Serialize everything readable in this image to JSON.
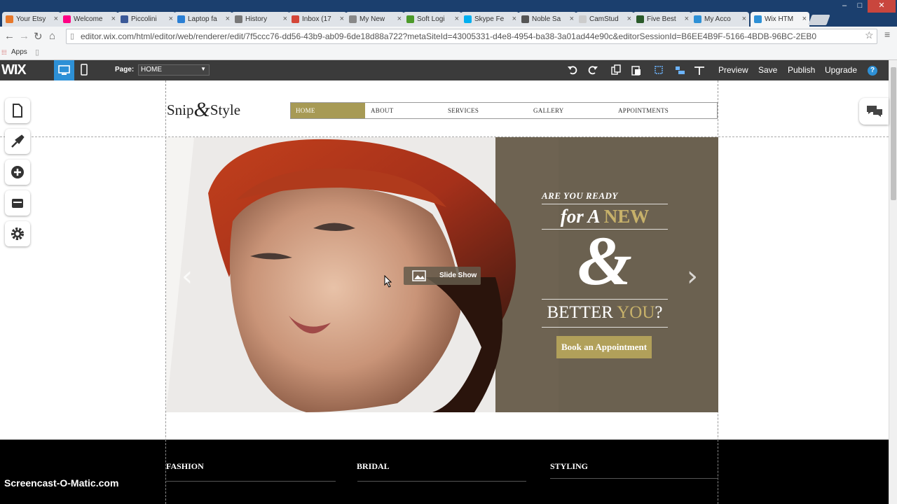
{
  "browser": {
    "tabs": [
      {
        "label": "Your Etsy",
        "color": "#e8782a"
      },
      {
        "label": "Welcome",
        "color": "#ff0084"
      },
      {
        "label": "Piccolini",
        "color": "#3b5998"
      },
      {
        "label": "Laptop fa",
        "color": "#2a7fd4"
      },
      {
        "label": "History",
        "color": "#777777"
      },
      {
        "label": "Inbox (17",
        "color": "#d44638"
      },
      {
        "label": "My New",
        "color": "#888888"
      },
      {
        "label": "Soft Logi",
        "color": "#4c9a2a"
      },
      {
        "label": "Skype Fe",
        "color": "#00aff0"
      },
      {
        "label": "Noble Sa",
        "color": "#555555"
      },
      {
        "label": "CamStud",
        "color": "#cccccc"
      },
      {
        "label": "Five Best",
        "color": "#2a5a2a"
      },
      {
        "label": "My Acco",
        "color": "#2d90d6"
      },
      {
        "label": "Wix HTM",
        "color": "#2d90d6"
      }
    ],
    "url": "editor.wix.com/html/editor/web/renderer/edit/7f5ccc76-dd56-43b9-ab09-6de18d88a722?metaSiteId=43005331-d4e8-4954-ba38-3a01ad44e90c&editorSessionId=B6EE4B9F-5166-4BDB-96BC-2EB0",
    "bookmarks_apps": "Apps"
  },
  "wix": {
    "logo": "WIX",
    "page_label": "Page:",
    "page_value": "HOME",
    "preview": "Preview",
    "save": "Save",
    "publish": "Publish",
    "upgrade": "Upgrade",
    "help": "?"
  },
  "site": {
    "logo_a": "Snip",
    "logo_amp": "&",
    "logo_b": "Style",
    "menu": [
      "HOME",
      "ABOUT",
      "SERVICES",
      "GALLERY",
      "APPOINTMENTS"
    ],
    "hero": {
      "line1": "ARE YOU READY",
      "line2a": "for A ",
      "line2b": "NEW",
      "amp": "&",
      "line3a": "BETTER ",
      "line3b": "YOU",
      "line3c": "?",
      "button": "Book an Appointment",
      "slideshow": "Slide Show"
    },
    "footer": [
      "FASHION",
      "BRIDAL",
      "STYLING"
    ]
  },
  "colors": {
    "accent_gold": "#b1a05a",
    "wix_blue": "#2d90d6",
    "hero_bg": "#6e6352"
  },
  "watermark": "Screencast-O-Matic.com"
}
